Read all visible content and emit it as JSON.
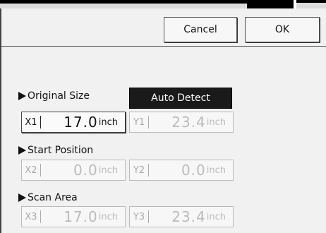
{
  "header": {
    "cancel_label": "Cancel",
    "ok_label": "OK"
  },
  "original_size": {
    "label": "Original Size",
    "auto_detect_label": "Auto Detect",
    "x": {
      "name": "X1",
      "value": "17.0",
      "unit": "inch"
    },
    "y": {
      "name": "Y1",
      "value": "23.4",
      "unit": "inch"
    }
  },
  "start_position": {
    "label": "Start Position",
    "x": {
      "name": "X2",
      "value": "0.0",
      "unit": "inch"
    },
    "y": {
      "name": "Y2",
      "value": "0.0",
      "unit": "inch"
    }
  },
  "scan_area": {
    "label": "Scan Area",
    "x": {
      "name": "X3",
      "value": "17.0",
      "unit": "inch"
    },
    "y": {
      "name": "Y3",
      "value": "23.4",
      "unit": "inch"
    }
  }
}
